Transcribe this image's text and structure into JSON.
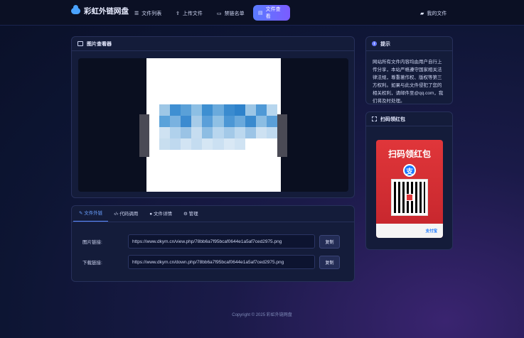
{
  "brand": {
    "name": "彩虹外链网盘"
  },
  "nav": {
    "items": [
      {
        "label": "文件列表",
        "icon": "list-icon"
      },
      {
        "label": "上传文件",
        "icon": "upload-icon"
      },
      {
        "label": "禁链名单",
        "icon": "block-list-icon"
      },
      {
        "label": "文件查看",
        "icon": "file-view-icon"
      }
    ],
    "right_label": "我的文件"
  },
  "viewer_panel": {
    "title": "图片查看器"
  },
  "details_panel": {
    "tabs": [
      "文件外链",
      "代码调用",
      "文件详情",
      "管理"
    ],
    "rows": [
      {
        "label": "图片链接:",
        "value": "https://www.dkym.cn/view.php/78bb6a7f95bcaf0644e1a5af7ced2975.png",
        "button": "复制"
      },
      {
        "label": "下载链接:",
        "value": "https://www.dkym.cn/down.php/78bb6a7f95bcaf0644e1a5af7ced2975.png",
        "button": "复制"
      }
    ]
  },
  "tip_panel": {
    "title": "提示",
    "text": "网站所有文件内容均由用户自行上传分享，本站严格遵守国家相关法律法规，尊重著作权、版权等第三方权利。如果与此文件侵犯了您的相关权利，请邮件至@qq.com，我们将及时处理。"
  },
  "redpack_panel": {
    "title": "扫码领红包",
    "card_title": "扫码领红包",
    "card_pay_icon": "支",
    "card_footer": "支付宝"
  },
  "footer": {
    "copyright": "Copyright © 2025 彩虹外链网盘"
  },
  "colors": {
    "accent": "#5a7bff",
    "background": "#0d1533",
    "panel": "#141c3a",
    "redpack": "#d92e33"
  }
}
